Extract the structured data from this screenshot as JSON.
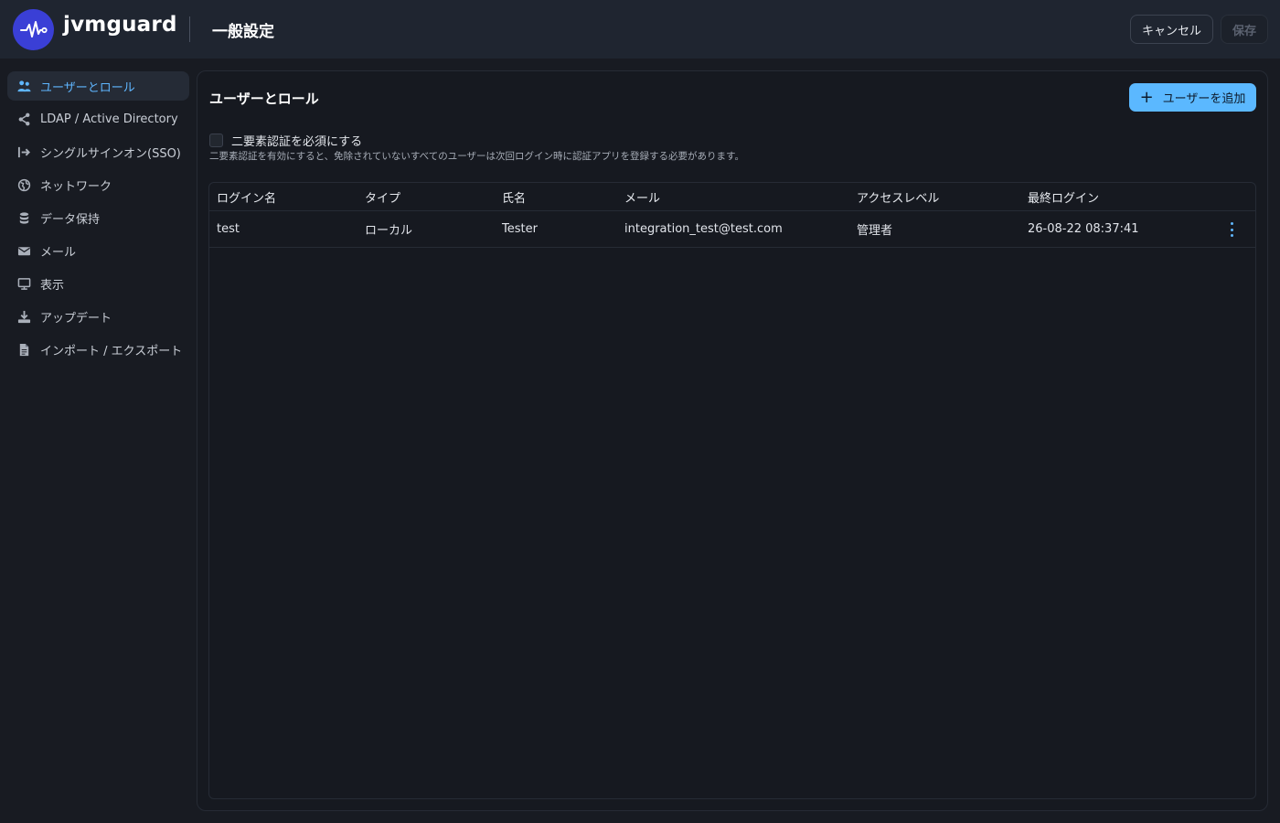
{
  "header": {
    "brand": "jvmguard",
    "page_title": "一般設定",
    "cancel_label": "キャンセル",
    "save_label": "保存"
  },
  "sidebar": {
    "items": [
      {
        "label": "ユーザーとロール",
        "icon": "users-icon",
        "active": true
      },
      {
        "label": "LDAP / Active Directory",
        "icon": "share-icon"
      },
      {
        "label": "シングルサインオン(SSO)",
        "icon": "sign-in-icon"
      },
      {
        "label": "ネットワーク",
        "icon": "globe-icon"
      },
      {
        "label": "データ保持",
        "icon": "database-icon"
      },
      {
        "label": "メール",
        "icon": "envelope-icon"
      },
      {
        "label": "表示",
        "icon": "monitor-icon"
      },
      {
        "label": "アップデート",
        "icon": "download-icon"
      },
      {
        "label": "インポート / エクスポート",
        "icon": "file-icon"
      }
    ]
  },
  "main": {
    "section_title": "ユーザーとロール",
    "add_user_label": "ユーザーを追加",
    "twofa": {
      "label": "二要素認証を必須にする",
      "description": "二要素認証を有効にすると、免除されていないすべてのユーザーは次回ログイン時に認証アプリを登録する必要があります。",
      "checked": false
    },
    "table": {
      "columns": [
        "ログイン名",
        "タイプ",
        "氏名",
        "メール",
        "アクセスレベル",
        "最終ログイン"
      ],
      "rows": [
        [
          "test",
          "ローカル",
          "Tester",
          "integration_test@test.com",
          "管理者",
          "26-08-22 08:37:41"
        ]
      ]
    }
  },
  "colors": {
    "accent": "#5bb8ff",
    "header_bg": "#1f2530",
    "body_bg": "#181b22",
    "logo_bg": "#3a3fd6"
  }
}
